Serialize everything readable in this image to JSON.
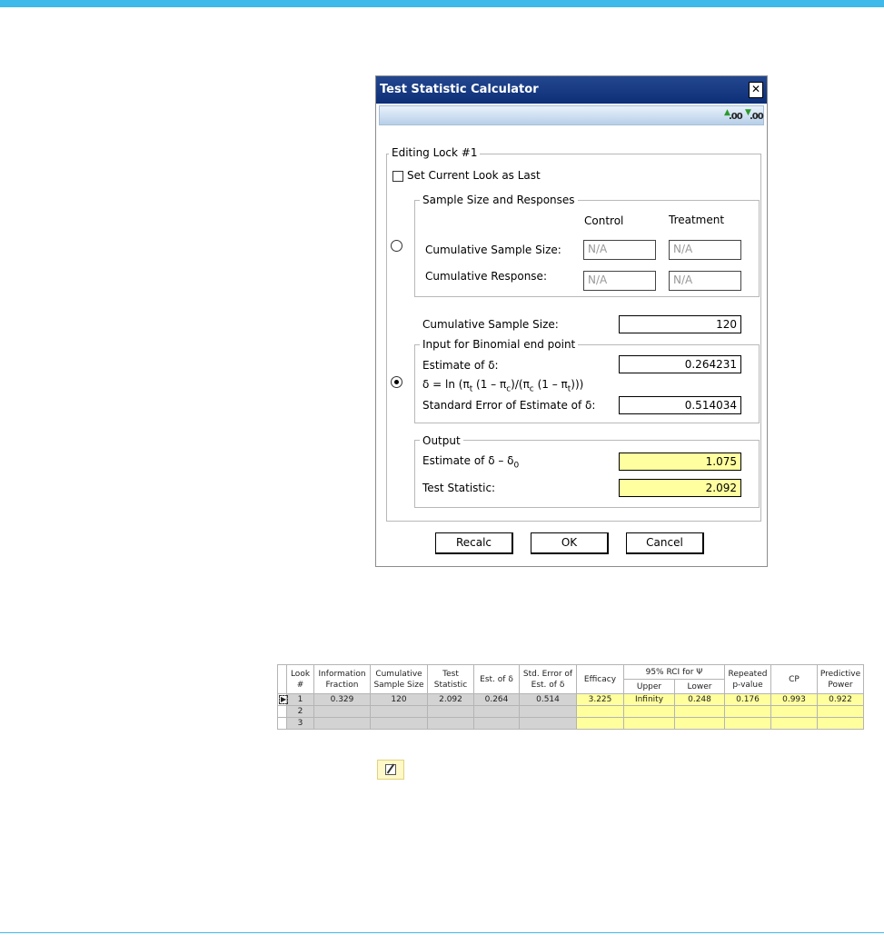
{
  "dialog": {
    "title": "Test Statistic Calculator",
    "close_label": "✕",
    "toolbar": {
      "increase_decimals": ".00",
      "decrease_decimals": ".00"
    },
    "lock_group": "Editing Lock #1",
    "set_last_label": "Set Current Look as Last",
    "set_last_checked": false,
    "sample_group": {
      "legend": "Sample Size and Responses",
      "col_control": "Control",
      "col_treatment": "Treatment",
      "row_sample_size": "Cumulative Sample Size:",
      "row_response": "Cumulative Response:",
      "control_sample": "N/A",
      "treatment_sample": "N/A",
      "control_response": "N/A",
      "treatment_response": "N/A"
    },
    "cum_sample_label": "Cumulative Sample Size:",
    "cum_sample_value": "120",
    "binomial_group": {
      "legend": "Input for Binomial end point",
      "estimate_label": "Estimate of δ:",
      "estimate_value": "0.264231",
      "formula_parts": [
        "δ = ln (π",
        "t",
        " (1 – π",
        "c",
        ")/(π",
        "c",
        " (1 – π",
        "t",
        ")))"
      ],
      "se_label": "Standard Error of Estimate of δ:",
      "se_value": "0.514034"
    },
    "output_group": {
      "legend": "Output",
      "est_label": "Estimate of δ – δ",
      "est_sub": "0",
      "est_value": "1.075",
      "ts_label": "Test Statistic:",
      "ts_value": "2.092"
    },
    "buttons": {
      "recalc": "Recalc",
      "ok": "OK",
      "cancel": "Cancel"
    }
  },
  "grid": {
    "headers": {
      "look": [
        "Look",
        "#"
      ],
      "info_fraction": [
        "Information",
        "Fraction"
      ],
      "cum_sample": [
        "Cumulative",
        "Sample Size"
      ],
      "test_stat": [
        "Test",
        "Statistic"
      ],
      "est_delta": "Est. of δ",
      "std_error": [
        "Std. Error of",
        "Est. of δ"
      ],
      "efficacy": "Efficacy",
      "rci": "95% RCI for Ψ",
      "upper": "Upper",
      "lower": "Lower",
      "repeated_p": [
        "Repeated",
        "p-value"
      ],
      "cp": "CP",
      "predictive": [
        "Predictive",
        "Power"
      ]
    },
    "rows": [
      {
        "look": "1",
        "info": "0.329",
        "sample": "120",
        "stat": "2.092",
        "est": "0.264",
        "se": "0.514",
        "efficacy": "3.225",
        "upper": "Infinity",
        "lower": "0.248",
        "p": "0.176",
        "cp": "0.993",
        "pp": "0.922"
      },
      {
        "look": "2",
        "info": "",
        "sample": "",
        "stat": "",
        "est": "",
        "se": "",
        "efficacy": "",
        "upper": "",
        "lower": "",
        "p": "",
        "cp": "",
        "pp": ""
      },
      {
        "look": "3",
        "info": "",
        "sample": "",
        "stat": "",
        "est": "",
        "se": "",
        "efficacy": "",
        "upper": "",
        "lower": "",
        "p": "",
        "cp": "",
        "pp": ""
      }
    ],
    "current_row_marker": "▶"
  },
  "colors": {
    "accent": "#3fb8ea",
    "titlebar": "#1a3d87",
    "output_fill": "#ffffa0",
    "grid_gray": "#d3d3d3"
  }
}
